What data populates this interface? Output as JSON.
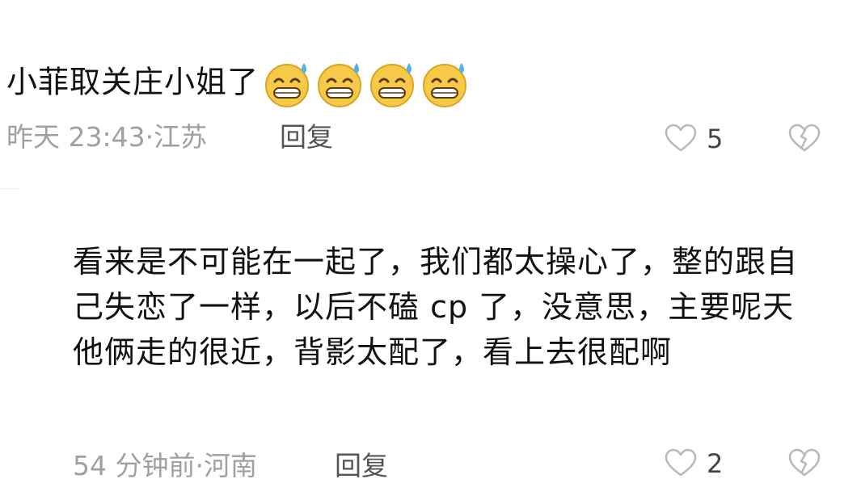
{
  "comments": [
    {
      "text": "小菲取关庄小姐了",
      "emojis": [
        "sweat-grin-icon",
        "sweat-grin-icon",
        "sweat-grin-icon",
        "sweat-grin-icon"
      ],
      "time_location": "昨天 23:43·江苏",
      "reply_label": "回复",
      "likes": "5"
    },
    {
      "text": "看来是不可能在一起了，我们都太操心了，整的跟自己失恋了一样，以后不磕 cp 了，没意思，主要呢天他俩走的很近，背影太配了，看上去很配啊",
      "time_location": "54 分钟前·河南",
      "reply_label": "回复",
      "likes": "2"
    }
  ],
  "colors": {
    "text": "#111111",
    "meta": "#a0a0a0",
    "reply": "#555555",
    "icon_stroke": "#b8b8b8",
    "emoji_face": "#f7c948",
    "emoji_sweat": "#4fb3ea"
  }
}
